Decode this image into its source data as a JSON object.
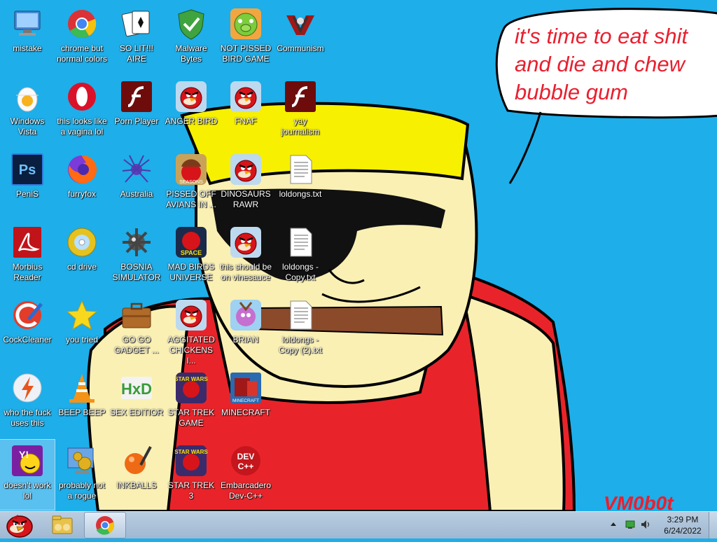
{
  "desktop": {
    "speech_text": [
      "it's time to eat shit",
      "and die and chew",
      "bubble gum"
    ],
    "signature": "VM0b0t",
    "icons": [
      {
        "label": "mistake",
        "icon": "computer-icon"
      },
      {
        "label": "chrome but normal colors",
        "icon": "chrome-icon"
      },
      {
        "label": "SO LIT!!! AIRE",
        "icon": "solitaire-cards-icon"
      },
      {
        "label": "Malware Bytes",
        "icon": "green-shield-icon"
      },
      {
        "label": "NOT PISSED BIRD GAME",
        "icon": "green-pig-icon"
      },
      {
        "label": "Communism",
        "icon": "red-emblem-icon"
      },
      {
        "label": "Windows Vista",
        "icon": "egg-icon"
      },
      {
        "label": "this looks like a vagina lol",
        "icon": "opera-icon"
      },
      {
        "label": "Porn Player",
        "icon": "flash-icon"
      },
      {
        "label": "ANGER BIRD",
        "icon": "angry-bird-icon"
      },
      {
        "label": "FNAF",
        "icon": "angry-bird-icon"
      },
      {
        "label": "yay journalism",
        "icon": "flash-icon"
      },
      {
        "label": "PeniS",
        "icon": "photoshop-icon"
      },
      {
        "label": "furryfox",
        "icon": "firefox-icon"
      },
      {
        "label": "Australia",
        "icon": "spider-solitaire-icon"
      },
      {
        "label": "PISSED OFF AVIANS IN ...",
        "icon": "angry-birds-seasons-icon"
      },
      {
        "label": "DINOSAURS RAWR",
        "icon": "angry-bird-icon"
      },
      {
        "label": "loldongs.txt",
        "icon": "text-file-icon"
      },
      {
        "label": "Morbius Reader",
        "icon": "acrobat-icon"
      },
      {
        "label": "cd drive",
        "icon": "cd-icon"
      },
      {
        "label": "BOSNIA SIMULATOR",
        "icon": "mine-icon"
      },
      {
        "label": "MAD BIRDS UNIVERSE",
        "icon": "angry-birds-space-icon"
      },
      {
        "label": "this should be on vinesauce",
        "icon": "angry-bird-icon"
      },
      {
        "label": "loldongs - Copy.txt",
        "icon": "text-file-icon"
      },
      {
        "label": "CockCleaner",
        "icon": "ccleaner-icon"
      },
      {
        "label": "you tried",
        "icon": "star-icon"
      },
      {
        "label": "GO GO GADGET ...",
        "icon": "briefcase-icon"
      },
      {
        "label": "AGGITATED CHICKENS I...",
        "icon": "angry-bird-icon"
      },
      {
        "label": "BRIAN",
        "icon": "angry-bird-slingshot-icon"
      },
      {
        "label": "loldongs - Copy (2).txt",
        "icon": "text-file-icon"
      },
      {
        "label": "who the fuck uses this",
        "icon": "bolt-icon"
      },
      {
        "label": "BEEP BEEP",
        "icon": "vlc-cone-icon"
      },
      {
        "label": "SEX EDITIOR",
        "icon": "hxd-icon"
      },
      {
        "label": "STAR TREK GAME",
        "icon": "angry-birds-star-wars-icon"
      },
      {
        "label": "MINECRAFT",
        "icon": "minecraft-icon"
      },
      {
        "label": "doesn't work lol",
        "icon": "yahoo-messenger-icon"
      },
      {
        "label": "probably not a rogue",
        "icon": "settings-computer-icon"
      },
      {
        "label": "INKBALLS",
        "icon": "inkball-icon"
      },
      {
        "label": "STAR TREK 3",
        "icon": "angry-birds-star-wars-icon"
      },
      {
        "label": "Embarcadero Dev-C++",
        "icon": "devcpp-icon"
      }
    ]
  },
  "taskbar": {
    "start_icon": "angry-bird-start-icon",
    "pinned": [
      "explorer-icon",
      "chrome-icon"
    ],
    "tray": {
      "time": "3:29 PM",
      "date": "6/24/2022",
      "icons": [
        "show-hidden-icon",
        "network-icon",
        "volume-icon"
      ]
    }
  },
  "colors": {
    "sky": "#1eaee9",
    "skin": "#faf0b4",
    "shirt": "#e8242a",
    "hat": "#f7f000",
    "speech_text": "#e8202f",
    "taskbar": "#b3c9de"
  }
}
